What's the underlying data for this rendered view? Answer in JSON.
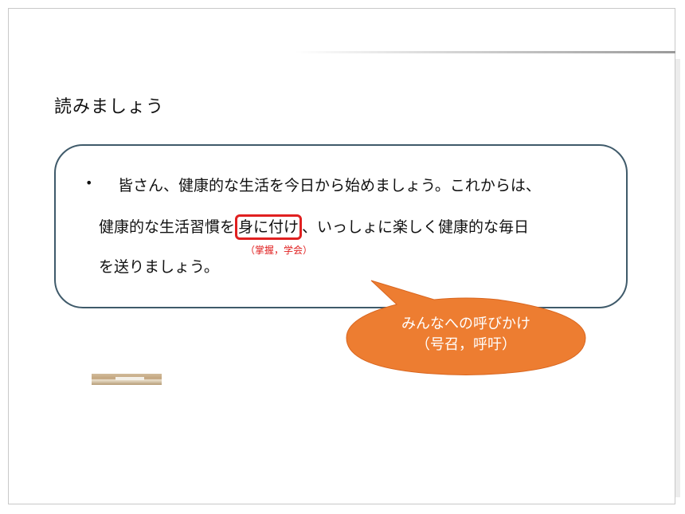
{
  "slide": {
    "title": "読みましょう"
  },
  "passage": {
    "bullet": "•",
    "line1": "皆さん、健康的な生活を今日から始めましょう。これからは、",
    "line2_before": "健康的な生活習慣を",
    "vocab": "身に付け",
    "line2_after": "、いっしょに楽しく健康的な毎日",
    "line3": "を送りましょう。",
    "vocab_gloss": "（掌握，学会）"
  },
  "callout": {
    "line1": "みんなへの呼びかけ",
    "line2": "（号召，呼吁）",
    "color": "#ED7D31"
  },
  "colors": {
    "box_border": "#3F5A6A",
    "highlight": "#E02020"
  }
}
